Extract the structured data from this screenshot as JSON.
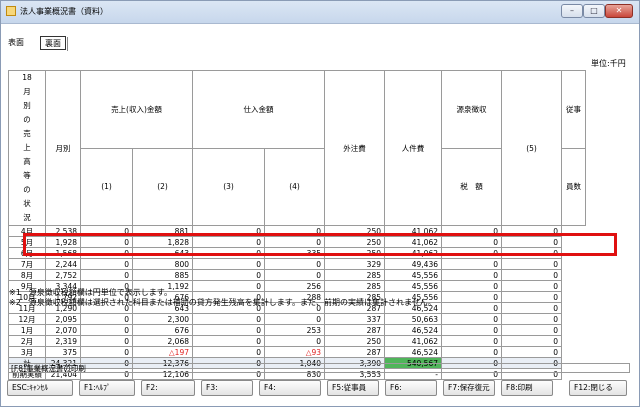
{
  "window": {
    "title": "法人事業概況書（資料）",
    "controls": {
      "minimize": "–",
      "maximize": "□",
      "close": "✕"
    }
  },
  "tabs": {
    "label": "表面",
    "active": "裏面"
  },
  "unit": "単位:千円",
  "side_label": [
    "18",
    "月",
    "別",
    "の",
    "売",
    "上",
    "高",
    "等",
    "の",
    "状",
    "況"
  ],
  "headers": {
    "month": "月別",
    "sales": "売上(収入)金額",
    "sales_1": "(1)",
    "sales_2": "(2)",
    "purchase": "仕入金額",
    "purchase_3": "(3)",
    "purchase_4": "(4)",
    "outsourcing": "外注費",
    "labor": "人件費",
    "withholding_1": "源泉徴収",
    "withholding_2": "税　額",
    "col5": "(5)",
    "employees_1": "従事",
    "employees_2": "員数"
  },
  "rows": [
    {
      "month": "4月",
      "s1": "2,538",
      "s2": "0",
      "p3": "881",
      "p4": "0",
      "out": "0",
      "labor": "250",
      "wh": "41,062",
      "c5": "0",
      "emp": "0"
    },
    {
      "month": "5月",
      "s1": "1,928",
      "s2": "0",
      "p3": "1,828",
      "p4": "0",
      "out": "0",
      "labor": "250",
      "wh": "41,062",
      "c5": "0",
      "emp": "0"
    },
    {
      "month": "6月",
      "s1": "1,568",
      "s2": "0",
      "p3": "643",
      "p4": "0",
      "out": "335",
      "labor": "250",
      "wh": "41,062",
      "c5": "0",
      "emp": "0"
    },
    {
      "month": "7月",
      "s1": "2,244",
      "s2": "0",
      "p3": "800",
      "p4": "0",
      "out": "0",
      "labor": "329",
      "wh": "49,436",
      "c5": "0",
      "emp": "0"
    },
    {
      "month": "8月",
      "s1": "2,752",
      "s2": "0",
      "p3": "885",
      "p4": "0",
      "out": "0",
      "labor": "285",
      "wh": "45,556",
      "c5": "0",
      "emp": "0"
    },
    {
      "month": "9月",
      "s1": "3,344",
      "s2": "0",
      "p3": "1,192",
      "p4": "0",
      "out": "256",
      "labor": "285",
      "wh": "45,556",
      "c5": "0",
      "emp": "0"
    },
    {
      "month": "10月",
      "s1": "1,792",
      "s2": "0",
      "p3": "676",
      "p4": "0",
      "out": "288",
      "labor": "285",
      "wh": "45,556",
      "c5": "0",
      "emp": "0"
    },
    {
      "month": "11月",
      "s1": "1,290",
      "s2": "0",
      "p3": "643",
      "p4": "0",
      "out": "0",
      "labor": "287",
      "wh": "46,524",
      "c5": "0",
      "emp": "0"
    },
    {
      "month": "12月",
      "s1": "2,095",
      "s2": "0",
      "p3": "2,300",
      "p4": "0",
      "out": "0",
      "labor": "337",
      "wh": "50,663",
      "c5": "0",
      "emp": "0"
    },
    {
      "month": "1月",
      "s1": "2,070",
      "s2": "0",
      "p3": "676",
      "p4": "0",
      "out": "253",
      "labor": "287",
      "wh": "46,524",
      "c5": "0",
      "emp": "0"
    },
    {
      "month": "2月",
      "s1": "2,319",
      "s2": "0",
      "p3": "2,068",
      "p4": "0",
      "out": "0",
      "labor": "250",
      "wh": "41,062",
      "c5": "0",
      "emp": "0"
    }
  ],
  "highlight_row": {
    "month": "3月",
    "s1": "375",
    "s2": "0",
    "p3": "△197",
    "p4": "0",
    "out": "△93",
    "labor": "287",
    "wh": "46,524",
    "c5": "0",
    "emp": "0"
  },
  "total_row": {
    "month": "計",
    "s1": "24,321",
    "s2": "0",
    "p3": "12,376",
    "p4": "0",
    "out": "1,040",
    "labor": "3,390",
    "wh": "540,567",
    "c5": "0",
    "emp": "0"
  },
  "prev_row": {
    "month": "前期実績",
    "s1": "21,404",
    "s2": "0",
    "p3": "12,106",
    "p4": "0",
    "out": "830",
    "labor": "3,553",
    "wh": "-",
    "c5": "0",
    "emp": "0"
  },
  "notes": [
    "※1　源泉徴収税額欄は円単位で表示します。",
    "※2　源泉徴収税額欄は選択された科目または補助の貸方発生残高を集計します。また、前期の実績は集計されません。"
  ],
  "status_text": "[F8]事業概況書の印刷",
  "fkeys": [
    "ESC:ｷｬﾝｾﾙ",
    "F1:ﾍﾙﾌﾟ",
    "F2:",
    "F3:",
    "F4:",
    "F5:従事員",
    "F6:",
    "F7:保存復元",
    "F8:印刷",
    "F12:閉じる"
  ],
  "colors": {
    "highlight_border": "#e01010",
    "negative_text": "#e02020",
    "total_green": "#4fb55a"
  }
}
